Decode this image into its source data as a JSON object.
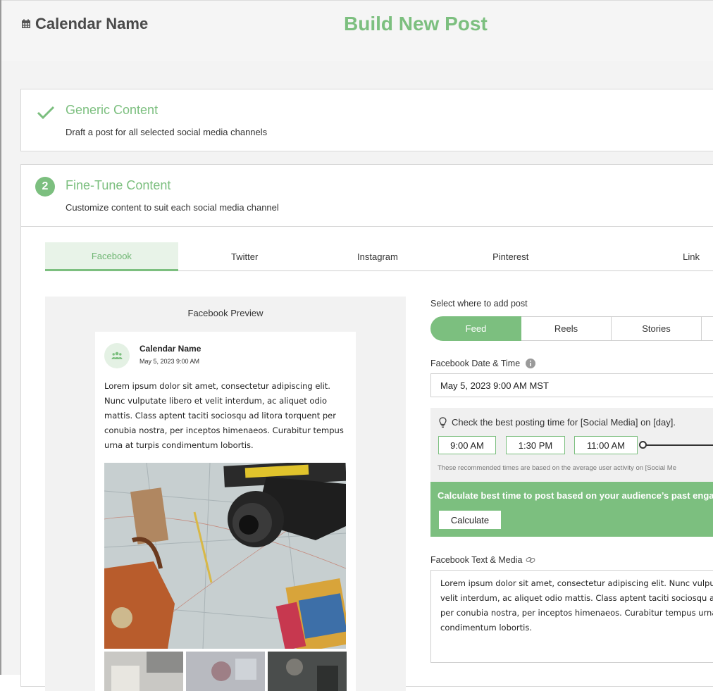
{
  "header": {
    "calendar_icon": "calendar-icon",
    "calendar_name": "Calendar Name",
    "page_title": "Build New Post"
  },
  "steps": {
    "generic": {
      "icon": "checkmark-icon",
      "title": "Generic Content",
      "description": "Draft a post for all selected social media channels"
    },
    "finetune": {
      "number": "2",
      "title": "Fine-Tune Content",
      "description": "Customize content to suit each social media channel"
    }
  },
  "tabs": [
    {
      "label": "Facebook",
      "active": true
    },
    {
      "label": "Twitter",
      "active": false
    },
    {
      "label": "Instagram",
      "active": false
    },
    {
      "label": "Pinterest",
      "active": false
    },
    {
      "label": "Link",
      "active": false
    }
  ],
  "preview": {
    "title": "Facebook Preview",
    "avatar_icon": "group-icon",
    "name": "Calendar Name",
    "date": "May 5, 2023 9:00 AM",
    "body": "Lorem ipsum dolor sit amet, consectetur adipiscing elit. Nunc vulputate libero et velit interdum, ac aliquet odio mattis. Class aptent taciti sociosqu ad litora torquent per conubia nostra, per inceptos himenaeos. Curabitur tempus urna at turpis condimentum lobortis."
  },
  "placement": {
    "label": "Select where to add post",
    "options": [
      "Feed",
      "Reels",
      "Stories"
    ],
    "selected": "Feed"
  },
  "datetime": {
    "label": "Facebook Date & Time",
    "info_icon": "info-icon",
    "value": "May 5, 2023 9:00 AM MST"
  },
  "best_time": {
    "icon": "lightbulb-icon",
    "question": "Check the best posting time for [Social Media] on [day].",
    "times": [
      "9:00 AM",
      "1:30 PM",
      "11:00 AM"
    ],
    "note": "These recommended times are based on the average user activity on [Social Me"
  },
  "calculate": {
    "text": "Calculate best time to post based on your audience’s past engag",
    "button": "Calculate"
  },
  "text_media": {
    "label": "Facebook Text & Media",
    "link_icon": "link-icon",
    "lines": [
      "Lorem ipsum dolor sit amet, consectetur adipiscing elit. Nunc vulpu",
      "velit interdum, ac aliquet odio mattis. Class aptent taciti sociosqu ad",
      "per conubia nostra, per inceptos himenaeos. Curabitur tempus urna",
      "condimentum lobortis."
    ]
  },
  "colors": {
    "accent": "#7cbf7f",
    "tab_active_bg": "#e8f3e8"
  }
}
